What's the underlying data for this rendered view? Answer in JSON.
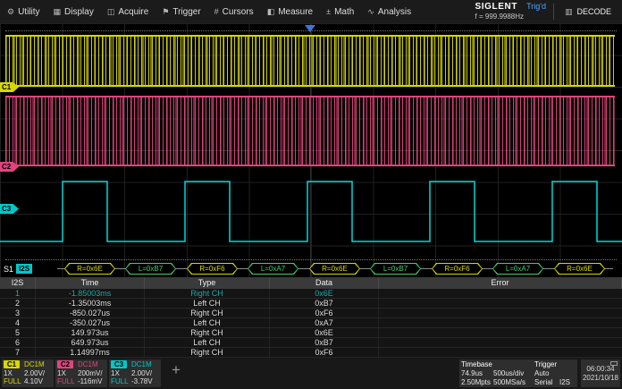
{
  "menubar": {
    "items": [
      {
        "label": "Utility",
        "icon": "utility-icon",
        "glyph": "⚙"
      },
      {
        "label": "Display",
        "icon": "display-icon",
        "glyph": "▦"
      },
      {
        "label": "Acquire",
        "icon": "acquire-icon",
        "glyph": "◫"
      },
      {
        "label": "Trigger",
        "icon": "trigger-icon",
        "glyph": "⚑"
      },
      {
        "label": "Cursors",
        "icon": "cursors-icon",
        "glyph": "#"
      },
      {
        "label": "Measure",
        "icon": "measure-icon",
        "glyph": "◧"
      },
      {
        "label": "Math",
        "icon": "math-icon",
        "glyph": "±"
      },
      {
        "label": "Analysis",
        "icon": "analysis-icon",
        "glyph": "∿"
      }
    ],
    "brand": "SIGLENT",
    "trig_status": "Trig'd",
    "frequency": "f = 999.9988Hz",
    "decode_label": "DECODE",
    "decode_glyph": "▥"
  },
  "waveform": {
    "channel_tags": [
      {
        "id": "C1",
        "color": "#d8d800"
      },
      {
        "id": "C2",
        "color": "#e0447e"
      },
      {
        "id": "C3",
        "color": "#00c8c8"
      }
    ],
    "bus_label": {
      "prefix": "S1",
      "chip": "I2S"
    },
    "decode_bubbles": [
      {
        "text": "R=0x6E",
        "channel": "right"
      },
      {
        "text": "L=0xB7",
        "channel": "left"
      },
      {
        "text": "R=0xF6",
        "channel": "right"
      },
      {
        "text": "L=0xA7",
        "channel": "left"
      },
      {
        "text": "R=0x6E",
        "channel": "right"
      },
      {
        "text": "L=0xB7",
        "channel": "left"
      },
      {
        "text": "R=0xF6",
        "channel": "right"
      },
      {
        "text": "L=0xA7",
        "channel": "left"
      },
      {
        "text": "R=0x6E",
        "channel": "right"
      }
    ]
  },
  "decode_table": {
    "columns": [
      "I2S",
      "Time",
      "Type",
      "Data",
      "Error"
    ],
    "rows": [
      {
        "idx": "1",
        "time": "-1.85003ms",
        "type": "Right CH",
        "data": "0x6E",
        "error": ""
      },
      {
        "idx": "2",
        "time": "-1.35003ms",
        "type": "Left CH",
        "data": "0xB7",
        "error": ""
      },
      {
        "idx": "3",
        "time": "-850.027us",
        "type": "Right CH",
        "data": "0xF6",
        "error": ""
      },
      {
        "idx": "4",
        "time": "-350.027us",
        "type": "Left CH",
        "data": "0xA7",
        "error": ""
      },
      {
        "idx": "5",
        "time": "149.973us",
        "type": "Right CH",
        "data": "0x6E",
        "error": ""
      },
      {
        "idx": "6",
        "time": "649.973us",
        "type": "Left CH",
        "data": "0xB7",
        "error": ""
      },
      {
        "idx": "7",
        "time": "1.14997ms",
        "type": "Right CH",
        "data": "0xF6",
        "error": ""
      }
    ],
    "selected_row": 1
  },
  "statusbar": {
    "channels": [
      {
        "id": "C1",
        "coupling": "DC1M",
        "probe": "1X",
        "scale": "2.00V/",
        "bw": "FULL",
        "offset": "4.10V"
      },
      {
        "id": "C2",
        "coupling": "DC1M",
        "probe": "1X",
        "scale": "200mV/",
        "bw": "FULL",
        "offset": "-116mV"
      },
      {
        "id": "C3",
        "coupling": "DC1M",
        "probe": "1X",
        "scale": "2.00V/",
        "bw": "FULL",
        "offset": "-3.78V"
      }
    ],
    "timebase": {
      "title": "Timebase",
      "delay": "74.9us",
      "scale": "500us/div",
      "mem": "2.50Mpts",
      "rate": "500MSa/s"
    },
    "trigger": {
      "title": "Trigger",
      "mode": "Auto",
      "type": "Serial",
      "protocol": "I2S"
    },
    "clock": {
      "time": "06:00:34",
      "date": "2021/10/18"
    }
  },
  "colors": {
    "c1": "#d8d800",
    "c2": "#e0447e",
    "c3": "#00c8c8",
    "trigd": "#4da6ff",
    "left_channel_decode": "#3fcf6e",
    "right_channel_decode": "#d8d800",
    "selected_row_text": "#1fa8a8"
  }
}
